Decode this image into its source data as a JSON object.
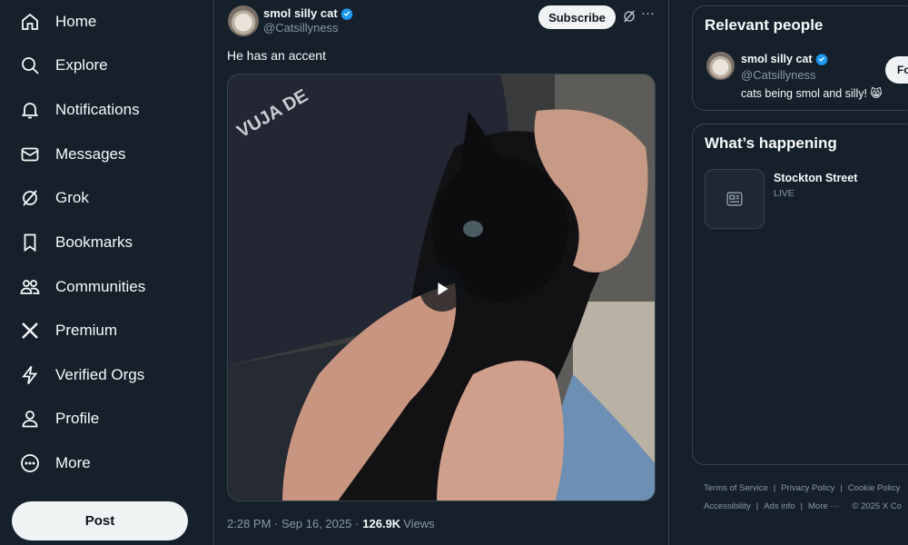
{
  "nav": {
    "items": [
      {
        "label": "Home",
        "icon": "home-icon"
      },
      {
        "label": "Explore",
        "icon": "search-icon"
      },
      {
        "label": "Notifications",
        "icon": "bell-icon"
      },
      {
        "label": "Messages",
        "icon": "envelope-icon"
      },
      {
        "label": "Grok",
        "icon": "grok-icon"
      },
      {
        "label": "Bookmarks",
        "icon": "bookmark-icon"
      },
      {
        "label": "Communities",
        "icon": "communities-icon"
      },
      {
        "label": "Premium",
        "icon": "x-logo-icon"
      },
      {
        "label": "Verified Orgs",
        "icon": "lightning-icon"
      },
      {
        "label": "Profile",
        "icon": "person-icon"
      },
      {
        "label": "More",
        "icon": "more-circle-icon"
      }
    ],
    "post_label": "Post"
  },
  "tweet": {
    "author_name": "smol silly cat",
    "author_handle": "@Catsillyness",
    "subscribe_label": "Subscribe",
    "text": "He has an accent",
    "timestamp": "2:28 PM · Sep 16, 2025 ·",
    "views_count": "126.9K",
    "views_label": "Views",
    "media_type": "video"
  },
  "relevant_people": {
    "title": "Relevant people",
    "person": {
      "name": "smol silly cat",
      "handle": "@Catsillyness",
      "bio": "cats being smol and silly! 😸",
      "follow_label": "Fo"
    }
  },
  "happening": {
    "title": "What’s happening",
    "trend": {
      "title": "Stockton Street",
      "status": "LIVE"
    }
  },
  "footer": {
    "row1": [
      "Terms of Service",
      "Privacy Policy",
      "Cookie Policy"
    ],
    "row2": [
      "Accessibility",
      "Ads info",
      "More ···",
      "© 2025 X Co"
    ]
  },
  "colors": {
    "background": "#15202b",
    "border": "#38444d",
    "secondary_text": "#8b98a5",
    "verified_blue": "#1d9bf0"
  }
}
